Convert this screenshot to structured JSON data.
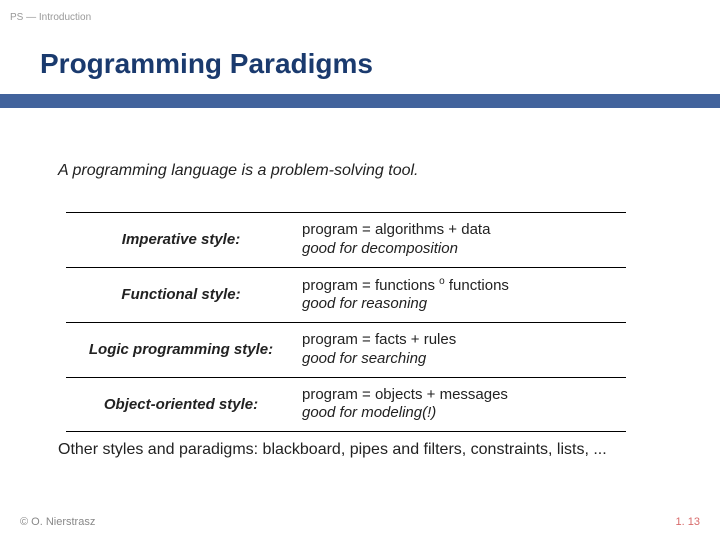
{
  "breadcrumb": "PS — Introduction",
  "title": "Programming Paradigms",
  "intro": "A programming language is a problem-solving tool.",
  "rows": [
    {
      "label": "Imperative style:",
      "line1": "program = algorithms + data",
      "line2": "good for decomposition"
    },
    {
      "label": "Functional style:",
      "line1_a": "program = functions ",
      "line1_sup": "o",
      "line1_b": " functions",
      "line2": "good for reasoning"
    },
    {
      "label": "Logic programming style:",
      "line1": "program = facts + rules",
      "line2": "good for searching"
    },
    {
      "label": "Object-oriented style:",
      "line1": "program = objects + messages",
      "line2": "good for modeling(!)"
    }
  ],
  "outro": "Other styles and paradigms: blackboard, pipes and filters, constraints, lists, ...",
  "copyright": "© O. Nierstrasz",
  "pagenum": "1. 13"
}
